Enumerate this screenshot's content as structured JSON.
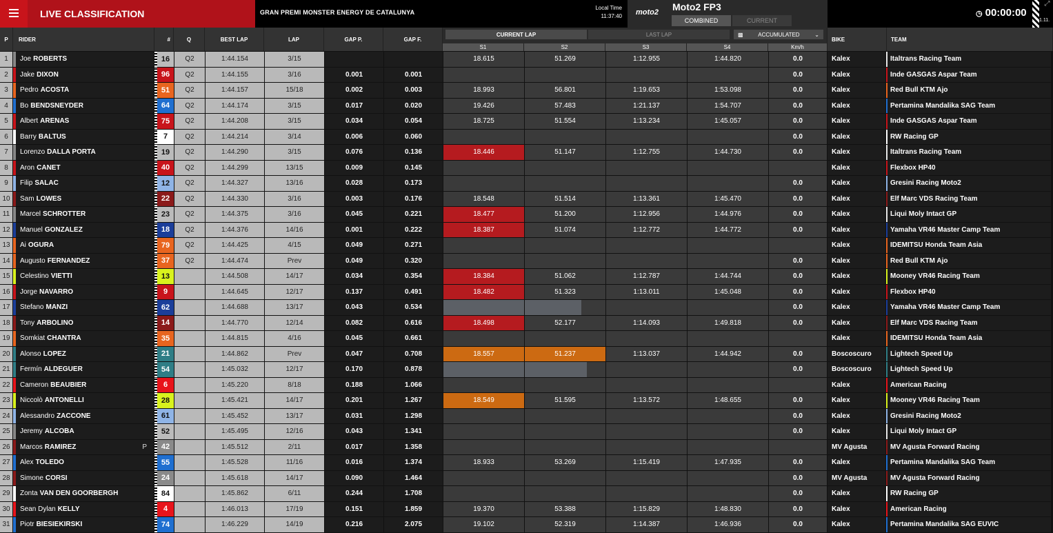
{
  "header": {
    "title": "LIVE CLASSIFICATION",
    "event": "GRAN PREMI MONSTER ENERGY DE CATALUNYA",
    "local_time_label": "Local Time",
    "local_time": "11:37:40",
    "brand": "moto2",
    "session": "Moto2 FP3",
    "mode_combined": "COMBINED",
    "mode_current": "CURRENT",
    "clock": "00:00:00",
    "version": "1.11."
  },
  "columns": {
    "pos": "P",
    "rider": "RIDER",
    "num": "#",
    "q": "Q",
    "best": "BEST LAP",
    "lap": "LAP",
    "gapp": "GAP P.",
    "gapf": "GAP F.",
    "current_lap": "CURRENT LAP",
    "last_lap": "LAST LAP",
    "accumulated": "ACCUMULATED",
    "s1": "S1",
    "s2": "S2",
    "s3": "S3",
    "s4": "S4",
    "kmh": "Km/h",
    "bike": "BIKE",
    "team": "TEAM"
  },
  "colors": {
    "red": "#b51b1f",
    "orange": "#cc6a12",
    "grey": "#5c6066"
  },
  "rows": [
    {
      "pos": "1",
      "first": "Joe",
      "last": "ROBERTS",
      "num": "16",
      "numbg": "#bbbbbb",
      "numfg": "#111111",
      "stripe": "#888888",
      "q": "Q2",
      "best": "1:44.154",
      "lap": "3/15",
      "gapp": "",
      "gapf": "",
      "s1": "18.615",
      "s2": "51.269",
      "s3": "1:12.955",
      "s4": "1:44.820",
      "kmh": "0.0",
      "bike": "Kalex",
      "team": "Italtrans Racing Team",
      "tc": "#e8e8e8"
    },
    {
      "pos": "2",
      "first": "Jake",
      "last": "DIXON",
      "num": "96",
      "numbg": "#c8141b",
      "numfg": "#ffffff",
      "stripe": "#c8141b",
      "q": "Q2",
      "best": "1:44.155",
      "lap": "3/16",
      "gapp": "0.001",
      "gapf": "0.001",
      "s1": "",
      "s2": "",
      "s3": "",
      "s4": "",
      "kmh": "0.0",
      "bike": "Kalex",
      "team": "Inde GASGAS Aspar Team",
      "tc": "#c8141b"
    },
    {
      "pos": "3",
      "first": "Pedro",
      "last": "ACOSTA",
      "num": "51",
      "numbg": "#e8651f",
      "numfg": "#ffffff",
      "stripe": "#e8651f",
      "q": "Q2",
      "best": "1:44.157",
      "lap": "15/18",
      "gapp": "0.002",
      "gapf": "0.003",
      "s1": "18.993",
      "s2": "56.801",
      "s3": "1:19.653",
      "s4": "1:53.098",
      "kmh": "0.0",
      "bike": "Kalex",
      "team": "Red Bull KTM Ajo",
      "tc": "#e8651f"
    },
    {
      "pos": "4",
      "first": "Bo",
      "last": "BENDSNEYDER",
      "num": "64",
      "numbg": "#1f6fd0",
      "numfg": "#ffffff",
      "stripe": "#1f6fd0",
      "q": "Q2",
      "best": "1:44.174",
      "lap": "3/15",
      "gapp": "0.017",
      "gapf": "0.020",
      "s1": "19.426",
      "s2": "57.483",
      "s3": "1:21.137",
      "s4": "1:54.707",
      "kmh": "0.0",
      "bike": "Kalex",
      "team": "Pertamina Mandalika SAG Team",
      "tc": "#1f6fd0"
    },
    {
      "pos": "5",
      "first": "Albert",
      "last": "ARENAS",
      "num": "75",
      "numbg": "#c8141b",
      "numfg": "#ffffff",
      "stripe": "#c8141b",
      "q": "Q2",
      "best": "1:44.208",
      "lap": "3/15",
      "gapp": "0.034",
      "gapf": "0.054",
      "s1": "18.725",
      "s2": "51.554",
      "s3": "1:13.234",
      "s4": "1:45.057",
      "kmh": "0.0",
      "bike": "Kalex",
      "team": "Inde GASGAS Aspar Team",
      "tc": "#c8141b"
    },
    {
      "pos": "6",
      "first": "Barry",
      "last": "BALTUS",
      "num": "7",
      "numbg": "#ffffff",
      "numfg": "#111111",
      "stripe": "#ffffff",
      "q": "Q2",
      "best": "1:44.214",
      "lap": "3/14",
      "gapp": "0.006",
      "gapf": "0.060",
      "s1": "",
      "s2": "",
      "s3": "",
      "s4": "",
      "kmh": "0.0",
      "bike": "Kalex",
      "team": "RW Racing GP",
      "tc": "#ffffff"
    },
    {
      "pos": "7",
      "first": "Lorenzo",
      "last": "DALLA PORTA",
      "num": "19",
      "numbg": "#bbbbbb",
      "numfg": "#111111",
      "stripe": "#888888",
      "q": "Q2",
      "best": "1:44.290",
      "lap": "3/15",
      "gapp": "0.076",
      "gapf": "0.136",
      "s1": "18.446",
      "s1c": "red",
      "s2": "51.147",
      "s3": "1:12.755",
      "s4": "1:44.730",
      "kmh": "0.0",
      "bike": "Kalex",
      "team": "Italtrans Racing Team",
      "tc": "#e8e8e8"
    },
    {
      "pos": "8",
      "first": "Aron",
      "last": "CANET",
      "num": "40",
      "numbg": "#c8141b",
      "numfg": "#ffffff",
      "stripe": "#c8141b",
      "q": "Q2",
      "best": "1:44.299",
      "lap": "13/15",
      "gapp": "0.009",
      "gapf": "0.145",
      "s1": "",
      "s2": "",
      "s3": "",
      "s4": "",
      "kmh": "",
      "bike": "Kalex",
      "team": "Flexbox HP40",
      "tc": "#c8141b"
    },
    {
      "pos": "9",
      "first": "Filip",
      "last": "SALAC",
      "num": "12",
      "numbg": "#8fb4e6",
      "numfg": "#111111",
      "stripe": "#8fb4e6",
      "q": "Q2",
      "best": "1:44.327",
      "lap": "13/16",
      "gapp": "0.028",
      "gapf": "0.173",
      "s1": "",
      "s2": "",
      "s3": "",
      "s4": "",
      "kmh": "0.0",
      "bike": "Kalex",
      "team": "Gresini Racing Moto2",
      "tc": "#8fb4e6"
    },
    {
      "pos": "10",
      "first": "Sam",
      "last": "LOWES",
      "num": "22",
      "numbg": "#8b1a1a",
      "numfg": "#ffffff",
      "stripe": "#8b1a1a",
      "q": "Q2",
      "best": "1:44.330",
      "lap": "3/16",
      "gapp": "0.003",
      "gapf": "0.176",
      "s1": "18.548",
      "s2": "51.514",
      "s3": "1:13.361",
      "s4": "1:45.470",
      "kmh": "0.0",
      "bike": "Kalex",
      "team": "Elf Marc VDS Racing Team",
      "tc": "#8b1a1a"
    },
    {
      "pos": "11",
      "first": "Marcel",
      "last": "SCHROTTER",
      "num": "23",
      "numbg": "#bbbbbb",
      "numfg": "#111111",
      "stripe": "#888888",
      "q": "Q2",
      "best": "1:44.375",
      "lap": "3/16",
      "gapp": "0.045",
      "gapf": "0.221",
      "s1": "18.477",
      "s1c": "red",
      "s2": "51.200",
      "s3": "1:12.956",
      "s4": "1:44.976",
      "kmh": "0.0",
      "bike": "Kalex",
      "team": "Liqui Moly Intact GP",
      "tc": "#e8e8e8"
    },
    {
      "pos": "12",
      "first": "Manuel",
      "last": "GONZALEZ",
      "num": "18",
      "numbg": "#1b3e9a",
      "numfg": "#ffffff",
      "stripe": "#1b3e9a",
      "q": "Q2",
      "best": "1:44.376",
      "lap": "14/16",
      "gapp": "0.001",
      "gapf": "0.222",
      "s1": "18.387",
      "s1c": "red",
      "s2": "51.074",
      "s3": "1:12.772",
      "s4": "1:44.772",
      "kmh": "0.0",
      "bike": "Kalex",
      "team": "Yamaha VR46 Master Camp Team",
      "tc": "#1b3e9a"
    },
    {
      "pos": "13",
      "first": "Ai",
      "last": "OGURA",
      "num": "79",
      "numbg": "#e8651f",
      "numfg": "#ffffff",
      "stripe": "#e8651f",
      "q": "Q2",
      "best": "1:44.425",
      "lap": "4/15",
      "gapp": "0.049",
      "gapf": "0.271",
      "s1": "",
      "s2": "",
      "s3": "",
      "s4": "",
      "kmh": "",
      "bike": "Kalex",
      "team": "IDEMITSU Honda Team Asia",
      "tc": "#e8651f"
    },
    {
      "pos": "14",
      "first": "Augusto",
      "last": "FERNANDEZ",
      "num": "37",
      "numbg": "#e8651f",
      "numfg": "#ffffff",
      "stripe": "#e8651f",
      "q": "Q2",
      "best": "1:44.474",
      "lap": "Prev",
      "gapp": "0.049",
      "gapf": "0.320",
      "s1": "",
      "s2": "",
      "s3": "",
      "s4": "",
      "kmh": "0.0",
      "bike": "Kalex",
      "team": "Red Bull KTM Ajo",
      "tc": "#e8651f"
    },
    {
      "pos": "15",
      "first": "Celestino",
      "last": "VIETTI",
      "num": "13",
      "numbg": "#d9f21d",
      "numfg": "#111111",
      "stripe": "#d9f21d",
      "q": "",
      "best": "1:44.508",
      "lap": "14/17",
      "gapp": "0.034",
      "gapf": "0.354",
      "s1": "18.384",
      "s1c": "red",
      "s2": "51.062",
      "s3": "1:12.787",
      "s4": "1:44.744",
      "kmh": "0.0",
      "bike": "Kalex",
      "team": "Mooney VR46 Racing Team",
      "tc": "#d9f21d"
    },
    {
      "pos": "16",
      "first": "Jorge",
      "last": "NAVARRO",
      "num": "9",
      "numbg": "#c8141b",
      "numfg": "#ffffff",
      "stripe": "#c8141b",
      "q": "",
      "best": "1:44.645",
      "lap": "12/17",
      "gapp": "0.137",
      "gapf": "0.491",
      "s1": "18.482",
      "s1c": "red",
      "s2": "51.323",
      "s3": "1:13.011",
      "s4": "1:45.048",
      "kmh": "0.0",
      "bike": "Kalex",
      "team": "Flexbox HP40",
      "tc": "#c8141b"
    },
    {
      "pos": "17",
      "first": "Stefano",
      "last": "MANZI",
      "num": "62",
      "numbg": "#1b3e9a",
      "numfg": "#ffffff",
      "stripe": "#1b3e9a",
      "q": "",
      "best": "1:44.688",
      "lap": "13/17",
      "gapp": "0.043",
      "gapf": "0.534",
      "s1": "",
      "s1c": "grey",
      "s2": "",
      "s2c": "grey",
      "s2f": 0.7,
      "s3": "",
      "s4": "",
      "kmh": "0.0",
      "bike": "Kalex",
      "team": "Yamaha VR46 Master Camp Team",
      "tc": "#1b3e9a"
    },
    {
      "pos": "18",
      "first": "Tony",
      "last": "ARBOLINO",
      "num": "14",
      "numbg": "#8b1a1a",
      "numfg": "#ffffff",
      "stripe": "#8b1a1a",
      "q": "",
      "best": "1:44.770",
      "lap": "12/14",
      "gapp": "0.082",
      "gapf": "0.616",
      "s1": "18.498",
      "s1c": "red",
      "s2": "52.177",
      "s3": "1:14.093",
      "s4": "1:49.818",
      "kmh": "0.0",
      "bike": "Kalex",
      "team": "Elf Marc VDS Racing Team",
      "tc": "#8b1a1a"
    },
    {
      "pos": "19",
      "first": "Somkiat",
      "last": "CHANTRA",
      "num": "35",
      "numbg": "#e8651f",
      "numfg": "#ffffff",
      "stripe": "#e8651f",
      "q": "",
      "best": "1:44.815",
      "lap": "4/16",
      "gapp": "0.045",
      "gapf": "0.661",
      "s1": "",
      "s2": "",
      "s3": "",
      "s4": "",
      "kmh": "",
      "bike": "Kalex",
      "team": "IDEMITSU Honda Team Asia",
      "tc": "#e8651f"
    },
    {
      "pos": "20",
      "first": "Alonso",
      "last": "LOPEZ",
      "num": "21",
      "numbg": "#2f7e86",
      "numfg": "#ffffff",
      "stripe": "#2f7e86",
      "q": "",
      "best": "1:44.862",
      "lap": "Prev",
      "gapp": "0.047",
      "gapf": "0.708",
      "s1": "18.557",
      "s1c": "orange",
      "s2": "51.237",
      "s2c": "orange",
      "s3": "1:13.037",
      "s4": "1:44.942",
      "kmh": "0.0",
      "bike": "Boscoscuro",
      "team": "Lightech Speed Up",
      "tc": "#2f7e86"
    },
    {
      "pos": "21",
      "first": "Fermín",
      "last": "ALDEGUER",
      "num": "54",
      "numbg": "#2f7e86",
      "numfg": "#ffffff",
      "stripe": "#2f7e86",
      "q": "",
      "best": "1:45.032",
      "lap": "12/17",
      "gapp": "0.170",
      "gapf": "0.878",
      "s1": "",
      "s1c": "grey",
      "s2": "",
      "s2c": "grey",
      "s2f": 0.77,
      "s3": "",
      "s4": "",
      "kmh": "0.0",
      "bike": "Boscoscuro",
      "team": "Lightech Speed Up",
      "tc": "#2f7e86"
    },
    {
      "pos": "22",
      "first": "Cameron",
      "last": "BEAUBIER",
      "num": "6",
      "numbg": "#e8141b",
      "numfg": "#ffffff",
      "stripe": "#e8141b",
      "q": "",
      "best": "1:45.220",
      "lap": "8/18",
      "gapp": "0.188",
      "gapf": "1.066",
      "s1": "",
      "s2": "",
      "s3": "",
      "s4": "",
      "kmh": "",
      "bike": "Kalex",
      "team": "American Racing",
      "tc": "#e8141b"
    },
    {
      "pos": "23",
      "first": "Niccolò",
      "last": "ANTONELLI",
      "num": "28",
      "numbg": "#d9f21d",
      "numfg": "#111111",
      "stripe": "#d9f21d",
      "q": "",
      "best": "1:45.421",
      "lap": "14/17",
      "gapp": "0.201",
      "gapf": "1.267",
      "s1": "18.549",
      "s1c": "orange",
      "s2": "51.595",
      "s3": "1:13.572",
      "s4": "1:48.655",
      "kmh": "0.0",
      "bike": "Kalex",
      "team": "Mooney VR46 Racing Team",
      "tc": "#d9f21d"
    },
    {
      "pos": "24",
      "first": "Alessandro",
      "last": "ZACCONE",
      "num": "61",
      "numbg": "#8fb4e6",
      "numfg": "#111111",
      "stripe": "#8fb4e6",
      "q": "",
      "best": "1:45.452",
      "lap": "13/17",
      "gapp": "0.031",
      "gapf": "1.298",
      "s1": "",
      "s2": "",
      "s3": "",
      "s4": "",
      "kmh": "0.0",
      "bike": "Kalex",
      "team": "Gresini Racing Moto2",
      "tc": "#8fb4e6"
    },
    {
      "pos": "25",
      "first": "Jeremy",
      "last": "ALCOBA",
      "num": "52",
      "numbg": "#bbbbbb",
      "numfg": "#111111",
      "stripe": "#888888",
      "q": "",
      "best": "1:45.495",
      "lap": "12/16",
      "gapp": "0.043",
      "gapf": "1.341",
      "s1": "",
      "s2": "",
      "s3": "",
      "s4": "",
      "kmh": "0.0",
      "bike": "Kalex",
      "team": "Liqui Moly Intact GP",
      "tc": "#e8e8e8"
    },
    {
      "pos": "26",
      "first": "Marcos",
      "last": "RAMIREZ",
      "flag": "P",
      "num": "42",
      "numbg": "#8a8a8a",
      "numfg": "#ffffff",
      "stripe": "#8a1a1a",
      "q": "",
      "best": "1:45.512",
      "lap": "2/11",
      "gapp": "0.017",
      "gapf": "1.358",
      "s1": "",
      "s2": "",
      "s3": "",
      "s4": "",
      "kmh": "",
      "bike": "MV Agusta",
      "team": "MV Agusta Forward Racing",
      "tc": "#8a1a1a"
    },
    {
      "pos": "27",
      "first": "Alex",
      "last": "TOLEDO",
      "num": "55",
      "numbg": "#1f6fd0",
      "numfg": "#ffffff",
      "stripe": "#1f6fd0",
      "q": "",
      "best": "1:45.528",
      "lap": "11/16",
      "gapp": "0.016",
      "gapf": "1.374",
      "s1": "18.933",
      "s2": "53.269",
      "s3": "1:15.419",
      "s4": "1:47.935",
      "kmh": "0.0",
      "bike": "Kalex",
      "team": "Pertamina Mandalika SAG Team",
      "tc": "#1f6fd0"
    },
    {
      "pos": "28",
      "first": "Simone",
      "last": "CORSI",
      "num": "24",
      "numbg": "#8a8a8a",
      "numfg": "#ffffff",
      "stripe": "#8a1a1a",
      "q": "",
      "best": "1:45.618",
      "lap": "14/17",
      "gapp": "0.090",
      "gapf": "1.464",
      "s1": "",
      "s2": "",
      "s3": "",
      "s4": "",
      "kmh": "0.0",
      "bike": "MV Agusta",
      "team": "MV Agusta Forward Racing",
      "tc": "#8a1a1a"
    },
    {
      "pos": "29",
      "first": "Zonta",
      "last": "VAN DEN GOORBERGH",
      "num": "84",
      "numbg": "#ffffff",
      "numfg": "#111111",
      "stripe": "#ffffff",
      "q": "",
      "best": "1:45.862",
      "lap": "6/11",
      "gapp": "0.244",
      "gapf": "1.708",
      "s1": "",
      "s2": "",
      "s3": "",
      "s4": "",
      "kmh": "0.0",
      "bike": "Kalex",
      "team": "RW Racing GP",
      "tc": "#ffffff"
    },
    {
      "pos": "30",
      "first": "Sean Dylan",
      "last": "KELLY",
      "num": "4",
      "numbg": "#e8141b",
      "numfg": "#ffffff",
      "stripe": "#e8141b",
      "q": "",
      "best": "1:46.013",
      "lap": "17/19",
      "gapp": "0.151",
      "gapf": "1.859",
      "s1": "19.370",
      "s2": "53.388",
      "s3": "1:15.829",
      "s4": "1:48.830",
      "kmh": "0.0",
      "bike": "Kalex",
      "team": "American Racing",
      "tc": "#e8141b"
    },
    {
      "pos": "31",
      "first": "Piotr",
      "last": "BIESIEKIRSKI",
      "num": "74",
      "numbg": "#1f6fd0",
      "numfg": "#ffffff",
      "stripe": "#1f6fd0",
      "q": "",
      "best": "1:46.229",
      "lap": "14/19",
      "gapp": "0.216",
      "gapf": "2.075",
      "s1": "19.102",
      "s2": "52.319",
      "s3": "1:14.387",
      "s4": "1:46.936",
      "kmh": "0.0",
      "bike": "Kalex",
      "team": "Pertamina Mandalika SAG EUVIC",
      "tc": "#1f6fd0"
    }
  ]
}
